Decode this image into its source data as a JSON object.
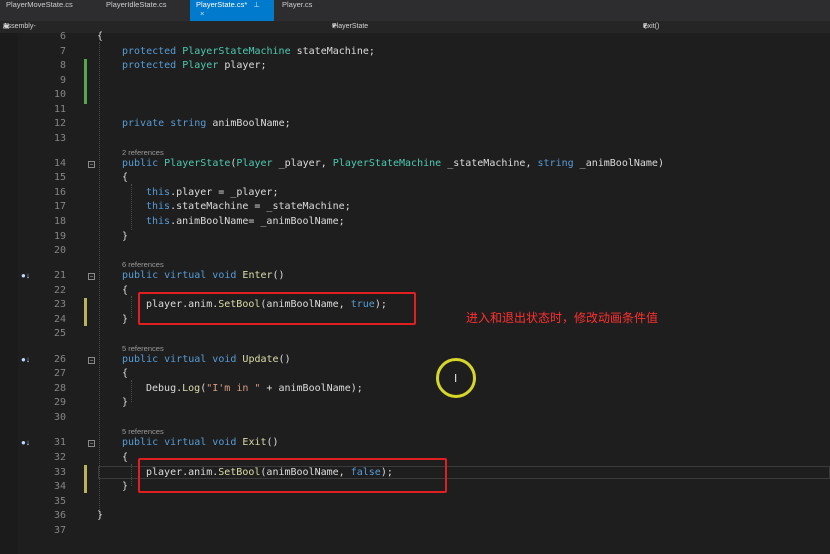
{
  "tabs": [
    {
      "label": "PlayerMoveState.cs"
    },
    {
      "label": "PlayerIdleState.cs"
    },
    {
      "label": "PlayerState.cs*",
      "pin": "⊥",
      "close": "×"
    },
    {
      "label": "Player.cs"
    }
  ],
  "navbar": {
    "project": "Assembly-CSharp",
    "class": "PlayerState",
    "member": "Exit()"
  },
  "line_numbers": [
    "6",
    "7",
    "8",
    "9",
    "10",
    "11",
    "12",
    "13",
    "14",
    "15",
    "16",
    "17",
    "18",
    "19",
    "20",
    "21",
    "22",
    "23",
    "24",
    "25",
    "26",
    "27",
    "28",
    "29",
    "30",
    "31",
    "32",
    "33",
    "34",
    "35",
    "36",
    "37"
  ],
  "references": {
    "ctor": "2 references",
    "enter": "6 references",
    "update": "5 references",
    "exit": "5 references"
  },
  "code": {
    "l6_open": "{",
    "l7": {
      "kw": "protected",
      "type": "PlayerStateMachine",
      "name": "stateMachine;"
    },
    "l8": {
      "kw": "protected",
      "type": "Player",
      "name": "player;"
    },
    "l12": {
      "kw": "private",
      "type": "string",
      "name": "animBoolName;"
    },
    "l14": {
      "kw": "public",
      "ctor": "PlayerState",
      "p1t": "Player",
      "p1": "_player,",
      "p2t": "PlayerStateMachine",
      "p2": "_stateMachine,",
      "p3t": "string",
      "p3": "_animBoolName)"
    },
    "l15": "{",
    "l16": {
      "this": "this",
      "rest": ".player = _player;"
    },
    "l17": {
      "this": "this",
      "rest": ".stateMachine = _stateMachine;"
    },
    "l18": {
      "this": "this",
      "rest": ".animBoolName= _animBoolName;"
    },
    "l19": "}",
    "l21": {
      "kw": "public virtual void",
      "fn": "Enter",
      "rest": "()"
    },
    "l22": "{",
    "l23": {
      "pre": "player.anim.",
      "fn": "SetBool",
      "mid": "(animBoolName, ",
      "val": "true",
      "post": ");"
    },
    "l24": "}",
    "l26": {
      "kw": "public virtual void",
      "fn": "Update",
      "rest": "()"
    },
    "l27": "{",
    "l28": {
      "pre": "Debug.",
      "fn": "Log",
      "open": "(",
      "str": "\"I'm in \"",
      "post": " + animBoolName);"
    },
    "l29": "}",
    "l31": {
      "kw": "public virtual void",
      "fn": "Exit",
      "rest": "()"
    },
    "l32": "{",
    "l33": {
      "pre": "player.anim.",
      "fn": "SetBool",
      "mid": "(animBoolName, ",
      "val": "false",
      "post": ");"
    },
    "l34": "}",
    "l36": "}"
  },
  "override_marker": "●↓",
  "annotation": "进入和退出状态时，修改动画条件值",
  "cursor_glyph": "I",
  "colors": {
    "keyword": "#569cd6",
    "type": "#4ec9b0",
    "method": "#dcdcaa",
    "string": "#d69d85",
    "highlight_box": "#e02020",
    "annotation_text": "#ff3030",
    "active_tab": "#007acc"
  }
}
